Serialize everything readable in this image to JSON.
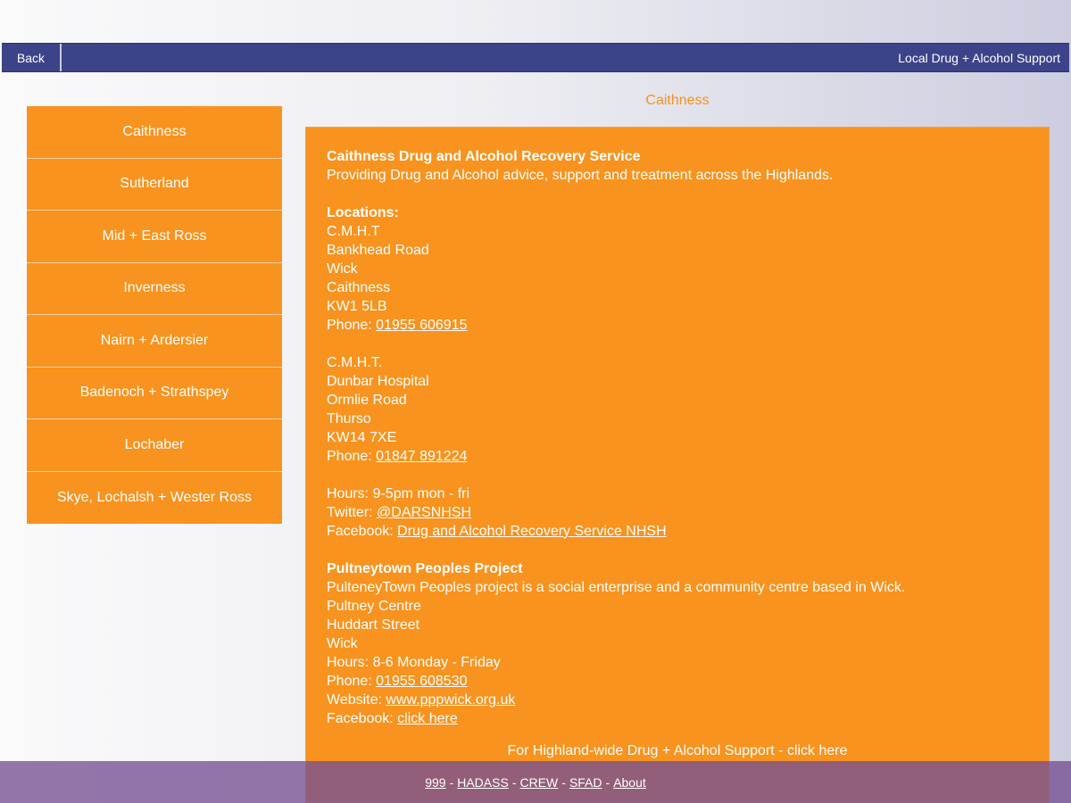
{
  "header": {
    "back_label": "Back",
    "title": "Local Drug + Alcohol Support"
  },
  "area_title": "Caithness",
  "sidebar": {
    "items": [
      {
        "label": "Caithness"
      },
      {
        "label": "Sutherland"
      },
      {
        "label": "Mid + East Ross"
      },
      {
        "label": "Inverness"
      },
      {
        "label": "Nairn + Ardersier"
      },
      {
        "label": "Badenoch + Strathspey"
      },
      {
        "label": "Lochaber"
      },
      {
        "label": "Skye, Lochalsh + Wester Ross"
      }
    ]
  },
  "content": {
    "dars": {
      "name": "Caithness Drug and Alcohol Recovery Service",
      "desc": "Providing Drug and Alcohol advice, support and treatment across the Highlands.",
      "locations_label": "Locations:",
      "loc1": [
        "C.M.H.T",
        "Bankhead Road",
        "Wick",
        "Caithness",
        "KW1 5LB"
      ],
      "loc1_phone_label": "Phone: ",
      "loc1_phone": "01955 606915",
      "loc2": [
        "C.M.H.T.",
        "Dunbar Hospital",
        "Ormlie Road",
        "Thurso",
        "KW14 7XE"
      ],
      "loc2_phone_label": "Phone: ",
      "loc2_phone": "01847 891224",
      "hours": "Hours: 9-5pm mon - fri",
      "twitter_label": "Twitter: ",
      "twitter": "@DARSNHSH",
      "facebook_label": "Facebook: ",
      "facebook": "Drug and Alcohol Recovery Service NHSH"
    },
    "ppp": {
      "name": "Pultneytown Peoples Project",
      "desc": "PulteneyTown Peoples project is a social enterprise and a community centre based in Wick.",
      "addr": [
        "Pultney Centre",
        "Huddart Street",
        "Wick"
      ],
      "hours": "Hours: 8-6 Monday - Friday",
      "phone_label": "Phone: ",
      "phone": "01955 608530",
      "website_label": "Website: ",
      "website": "www.pppwick.org.uk",
      "facebook_label": "Facebook: ",
      "facebook": "click here"
    },
    "highland_link": "For Highland-wide Drug + Alcohol Support - click here"
  },
  "footer": {
    "links": [
      "999",
      "HADASS",
      "CREW",
      "SFAD",
      "About"
    ],
    "separator": "-"
  }
}
